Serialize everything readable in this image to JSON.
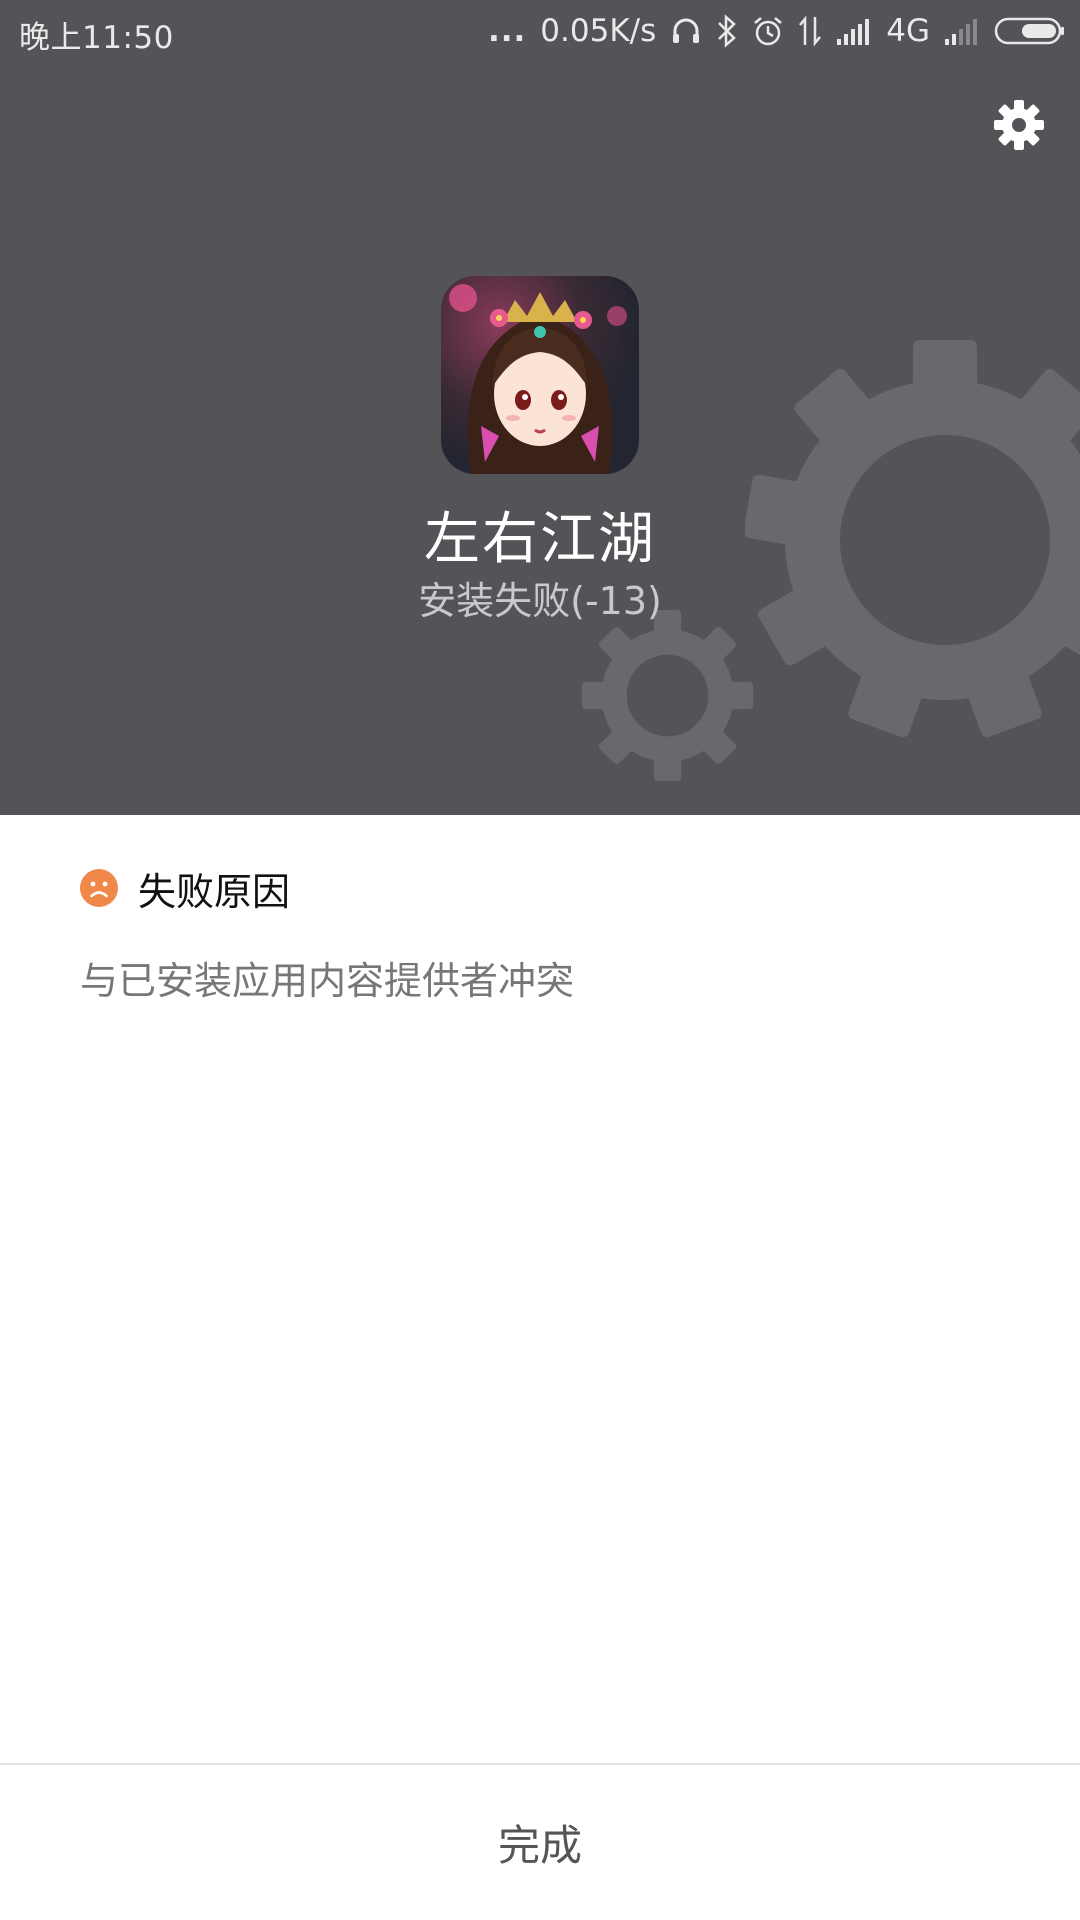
{
  "status_bar": {
    "time": "晚上11:50",
    "more": "...",
    "network_speed": "0.05K/s",
    "network_type": "4G",
    "icons": [
      "headphones-icon",
      "bluetooth-icon",
      "alarm-icon",
      "data-transfer-icon",
      "signal-icon",
      "signal-weak-icon",
      "battery-icon"
    ]
  },
  "header": {
    "settings_icon": "gear-icon",
    "background_decoration": "gears-icon",
    "app_icon": "app-game-icon",
    "app_name": "左右江湖",
    "install_status": "安装失败(-13)"
  },
  "reason": {
    "icon": "sad-face-icon",
    "title": "失败原因",
    "text": "与已安装应用内容提供者冲突"
  },
  "footer": {
    "done_label": "完成"
  },
  "colors": {
    "header_bg": "#545458",
    "accent_sad": "#f0884a",
    "decor_gear": "#6a6a6e"
  }
}
